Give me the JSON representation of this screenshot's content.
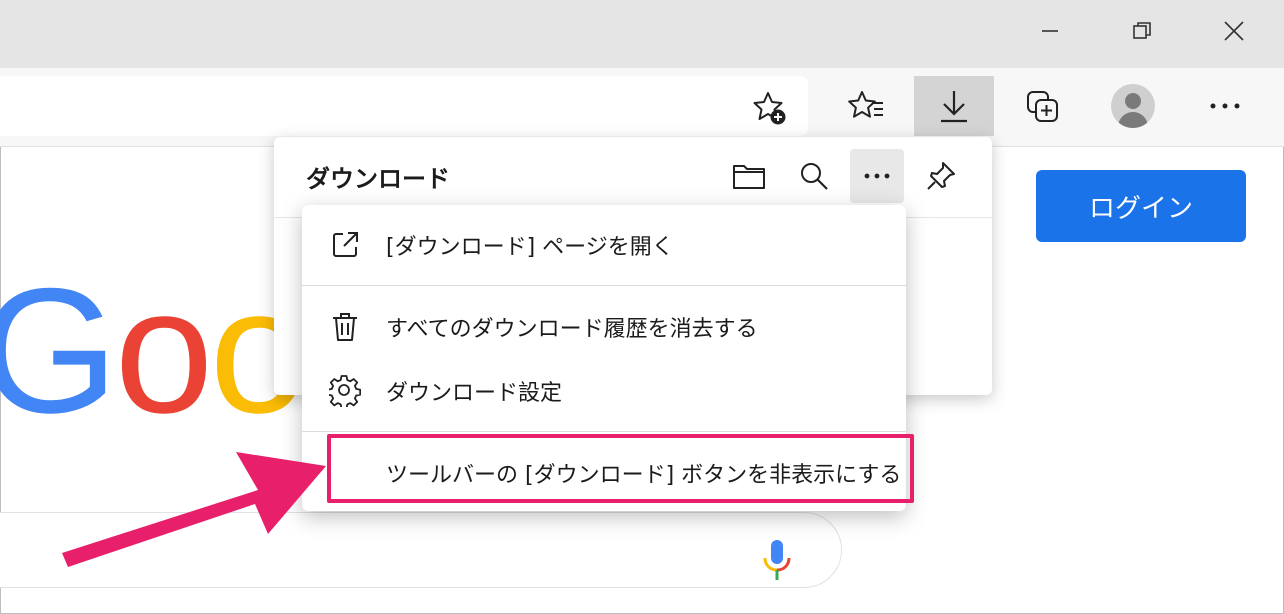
{
  "window": {
    "controls": [
      "minimize-icon",
      "restore-icon",
      "close-icon"
    ]
  },
  "toolbar": {
    "icons": [
      "add-favorite-icon",
      "favorites-icon",
      "downloads-icon",
      "collections-icon",
      "profile-icon",
      "more-icon"
    ],
    "active": "downloads-icon"
  },
  "page": {
    "login_label": "ログイン",
    "logo_text": [
      "G",
      "o",
      "o"
    ],
    "colors": {
      "blue": "#4285f4",
      "red": "#ea4335",
      "yellow": "#fbbc05",
      "login_bg": "#1a73e8"
    }
  },
  "downloads_panel": {
    "title": "ダウンロード",
    "icons": [
      "folder-icon",
      "search-icon",
      "more-icon",
      "pin-icon"
    ]
  },
  "menu": {
    "items": [
      {
        "label": "[ダウンロード] ページを開く",
        "icon": "open-external-icon"
      },
      {
        "label": "すべてのダウンロード履歴を消去する",
        "icon": "trash-icon"
      },
      {
        "label": "ダウンロード設定",
        "icon": "gear-icon"
      },
      {
        "label": "ツールバーの [ダウンロード] ボタンを非表示にする",
        "icon": ""
      }
    ],
    "highlighted_index": 3,
    "highlight_color": "#e8206b"
  }
}
